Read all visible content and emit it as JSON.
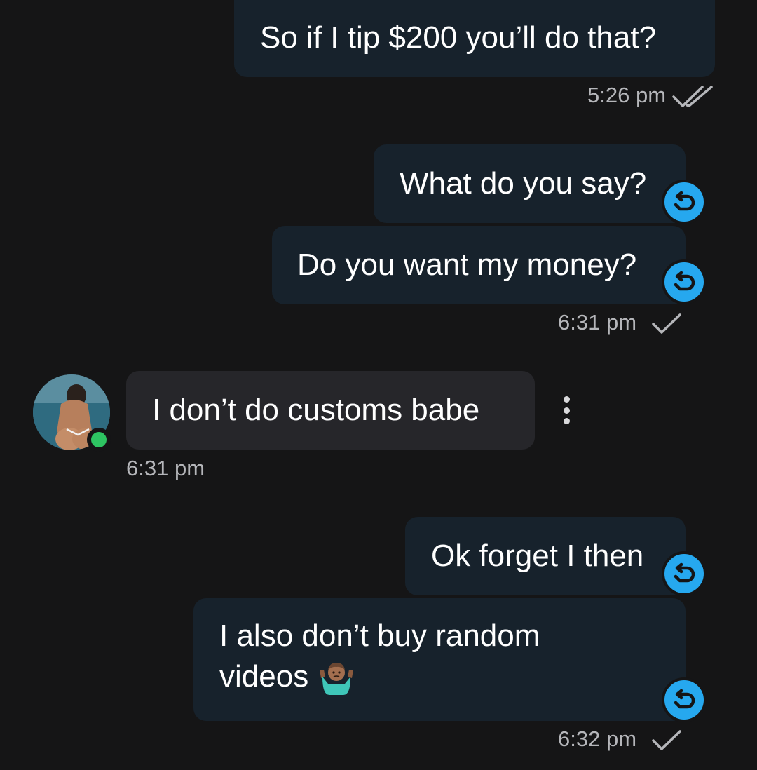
{
  "messages": [
    {
      "direction": "outgoing",
      "text": "So if I tip $200 you’ll do that?"
    },
    {
      "direction": "outgoing",
      "text": "What do you say?",
      "retry": true
    },
    {
      "direction": "outgoing",
      "text": "Do you want my money?",
      "retry": true
    },
    {
      "direction": "incoming",
      "text": "I don’t do customs babe"
    },
    {
      "direction": "outgoing",
      "text": "Ok forget I then",
      "retry": true
    },
    {
      "direction": "outgoing",
      "text_line1": "I also don’t buy random",
      "text_line2": "videos",
      "emoji": "person-shrugging-emoji",
      "retry": true
    }
  ],
  "timestamps": {
    "t1": "5:26 pm",
    "t2": "6:31 pm",
    "t3": "6:31 pm",
    "t4": "6:32 pm"
  },
  "status_icons": {
    "t1": "double-check-icon",
    "t2": "single-check-icon",
    "t4": "single-check-icon"
  },
  "icons": {
    "retry": "retry-arrow-icon",
    "more": "more-vertical-icon"
  },
  "colors": {
    "background": "#151516",
    "outgoing_bubble": "#17222c",
    "incoming_bubble": "#26262a",
    "retry_badge": "#26a8ef",
    "online_dot": "#2ec462",
    "timestamp": "#b5b6ba"
  }
}
